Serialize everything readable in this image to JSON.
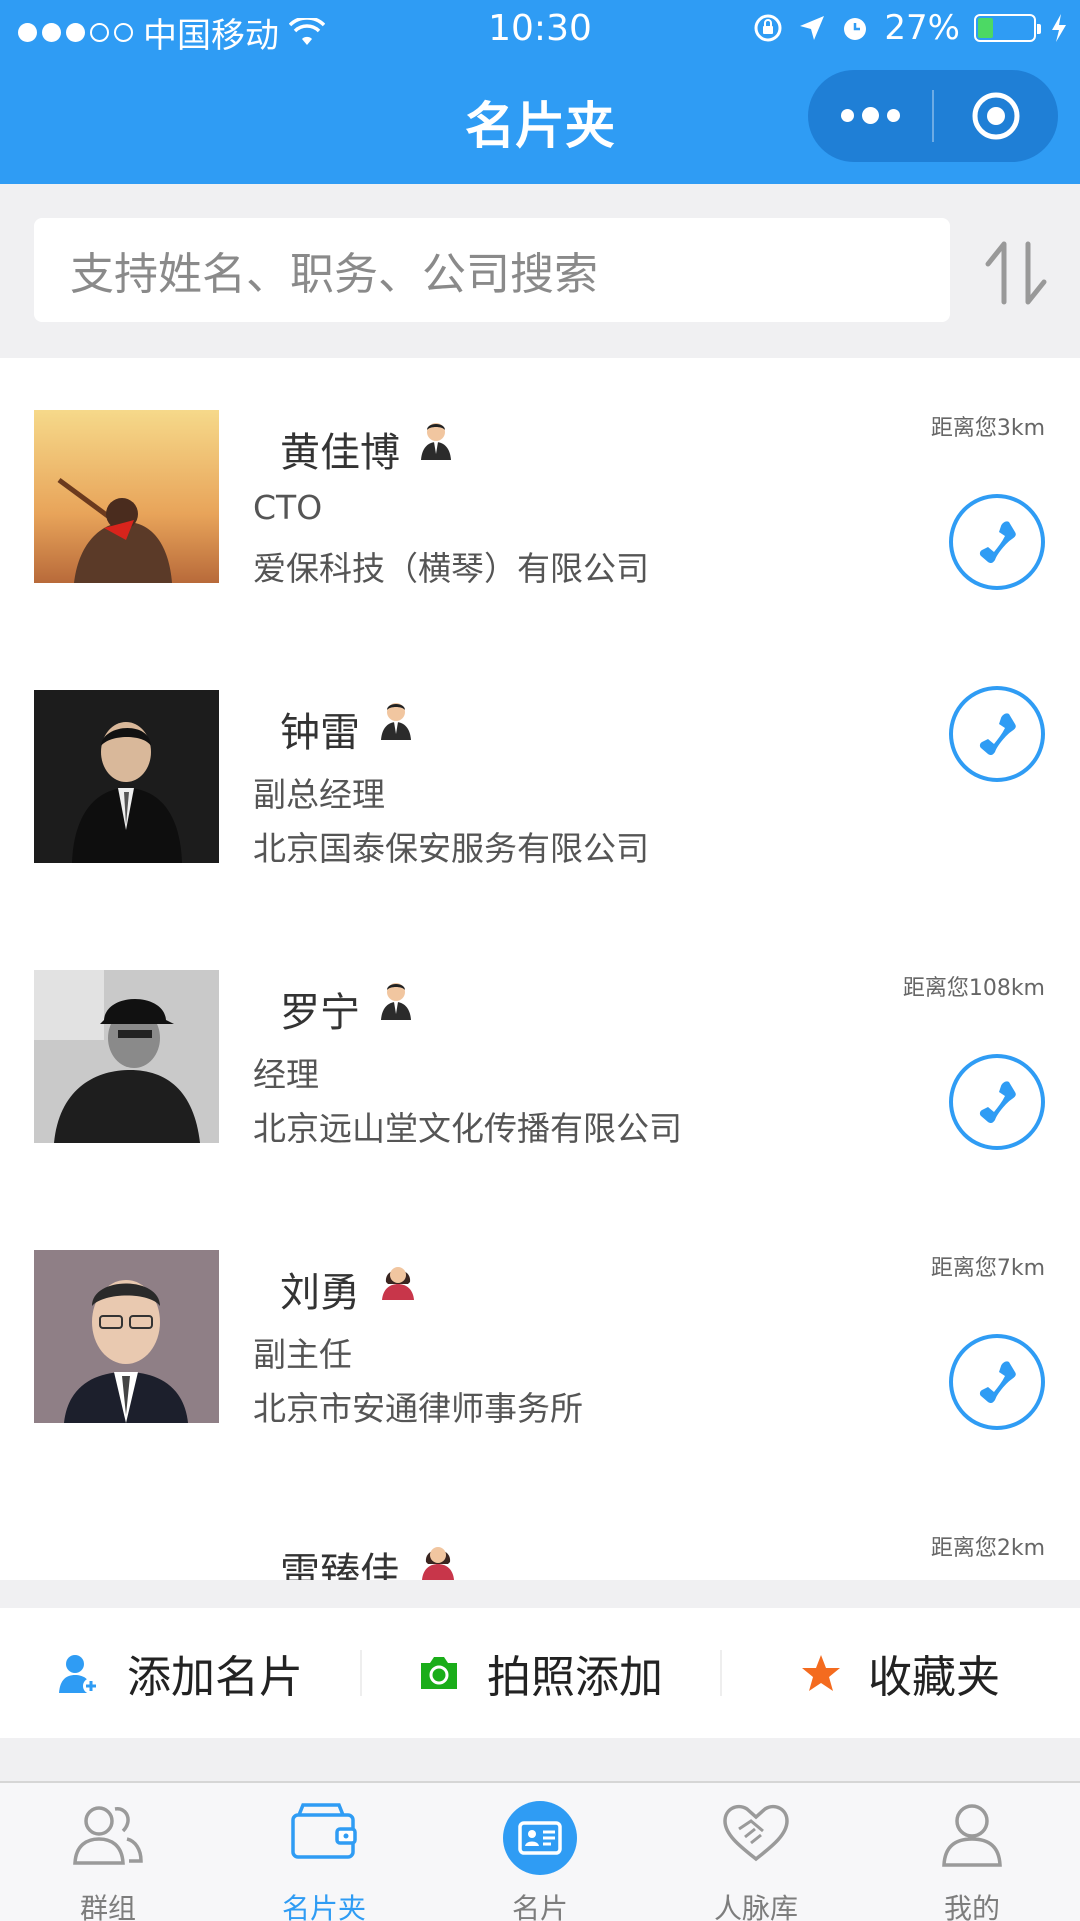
{
  "status_bar": {
    "carrier": "中国移动",
    "time": "10:30",
    "battery_percent": "27%",
    "battery_level": 0.27,
    "signal_bars_filled": 3,
    "signal_bars_total": 5
  },
  "nav": {
    "title": "名片夹"
  },
  "search": {
    "placeholder": "支持姓名、职务、公司搜索"
  },
  "contacts": [
    {
      "name": "黄佳博",
      "gender_icon": "male-icon",
      "title": "CTO",
      "company": "爱保科技（横琴）有限公司",
      "distance": "距离您3km"
    },
    {
      "name": "钟雷",
      "gender_icon": "male-icon",
      "title": "副总经理",
      "company": "北京国泰保安服务有限公司",
      "distance": ""
    },
    {
      "name": "罗宁",
      "gender_icon": "male-icon",
      "title": "经理",
      "company": "北京远山堂文化传播有限公司",
      "distance": "距离您108km"
    },
    {
      "name": "刘勇",
      "gender_icon": "female-icon",
      "title": "副主任",
      "company": "北京市安通律师事务所",
      "distance": "距离您7km"
    },
    {
      "name": "雷臻佳",
      "gender_icon": "female-icon",
      "title": "",
      "company": "",
      "distance": "距离您2km"
    }
  ],
  "actions": [
    {
      "label": "添加名片",
      "icon": "add-person-icon",
      "color": "#2f9cf4"
    },
    {
      "label": "拍照添加",
      "icon": "camera-icon",
      "color": "#1aad19"
    },
    {
      "label": "收藏夹",
      "icon": "star-icon",
      "color": "#f46b1f"
    }
  ],
  "tabs": [
    {
      "label": "群组",
      "icon": "group-icon",
      "active": false
    },
    {
      "label": "名片夹",
      "icon": "card-holder-icon",
      "active": true
    },
    {
      "label": "名片",
      "icon": "business-card-icon",
      "active": false
    },
    {
      "label": "人脉库",
      "icon": "handshake-icon",
      "active": false
    },
    {
      "label": "我的",
      "icon": "profile-icon",
      "active": false
    }
  ],
  "colors": {
    "primary": "#2f9cf4",
    "capsule": "#1f7fd6",
    "camera": "#1aad19",
    "star": "#f46b1f",
    "background": "#f0f0f2"
  }
}
